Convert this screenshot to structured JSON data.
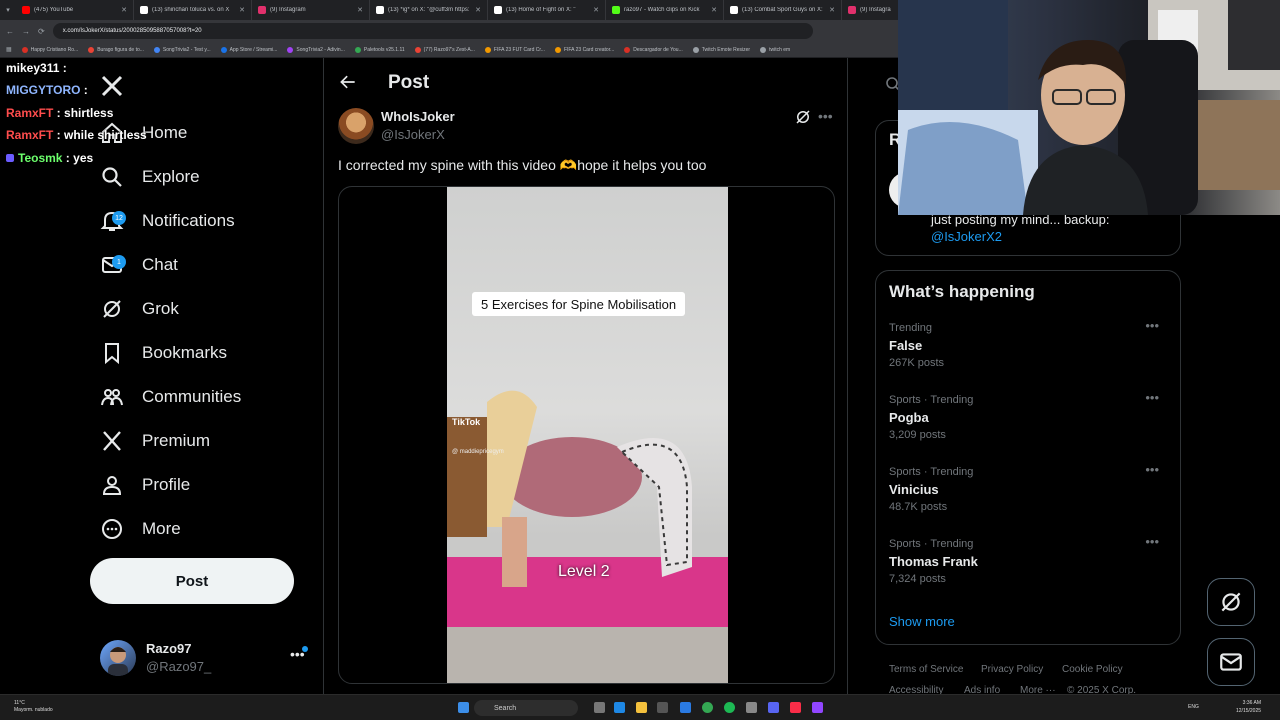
{
  "browser": {
    "tabs": [
      {
        "title": "(475) YouTube",
        "color": "#ff0000"
      },
      {
        "title": "(13) shinchan toluca vs. on X",
        "color": "#ffffff"
      },
      {
        "title": "(9) Instagram",
        "color": "#e1306c"
      },
      {
        "title": "(13) *ig* on X: \"@cuff3m https:",
        "color": "#ffffff"
      },
      {
        "title": "(13) Home of Fight on X: \"",
        "color": "#ffffff"
      },
      {
        "title": "razo97 - Watch clips on Kick",
        "color": "#53fc18"
      },
      {
        "title": "(13) Combat Sport Guys on X:",
        "color": "#ffffff"
      },
      {
        "title": "(9) Instagra",
        "color": "#e1306c"
      }
    ],
    "url": "x.com/IsJokerX/status/2000285095887057008?t=20",
    "bookmarks": [
      "Happy Cristiano Ro...",
      "Burago figura de to...",
      "SongTrivia2 - Test y...",
      "App Store / Streami...",
      "SongTrivia2 - Adivin...",
      "Paletools v25.1.11",
      "(77) Razo97's Zest-A...",
      "FIFA 23 FUT Card Cr...",
      "FIFA 23 Card creator...",
      "Descargador de You...",
      "Twitch Emote Resizer",
      "twitch em"
    ]
  },
  "chat": [
    {
      "user": "mikey311",
      "msg": "",
      "color": "#ffffff"
    },
    {
      "user": "MIGGYTORO",
      "msg": "",
      "color": "#8fb6ff"
    },
    {
      "user": "RamxFT",
      "msg": "shirtless",
      "color": "#ff4d4d"
    },
    {
      "user": "RamxFT",
      "msg": "while shirtless",
      "color": "#ff4d4d"
    },
    {
      "user": "Teosmk",
      "msg": "yes",
      "color": "#6cff6c"
    }
  ],
  "nav": {
    "items": [
      {
        "label": "Home",
        "icon": "home-icon"
      },
      {
        "label": "Explore",
        "icon": "search-icon"
      },
      {
        "label": "Notifications",
        "icon": "bell-icon",
        "badge": "12"
      },
      {
        "label": "Chat",
        "icon": "mail-icon",
        "badge": "1"
      },
      {
        "label": "Grok",
        "icon": "grok-icon"
      },
      {
        "label": "Bookmarks",
        "icon": "bookmark-icon"
      },
      {
        "label": "Communities",
        "icon": "communities-icon"
      },
      {
        "label": "Premium",
        "icon": "x-logo-icon"
      },
      {
        "label": "Profile",
        "icon": "profile-icon"
      },
      {
        "label": "More",
        "icon": "more-circle-icon"
      }
    ],
    "post_button": "Post",
    "account": {
      "name": "Razo97",
      "handle": "@Razo97_"
    }
  },
  "post": {
    "header_title": "Post",
    "author_name": "WhoIsJoker",
    "author_handle": "@IsJokerX",
    "text": "I corrected my spine with this video 🫶hope it helps you too",
    "video_caption": "5 Exercises for Spine Mobilisation",
    "video_level": "Level 2",
    "watermark": "TikTok",
    "watermark_handle": "@ maddiepricegym"
  },
  "sidebar": {
    "relevant_initial": "R",
    "relevant_bio": "just posting my mind... backup:",
    "relevant_link": "@IsJokerX2",
    "trends_title": "What’s happening",
    "trends": [
      {
        "context": "Trending",
        "name": "False",
        "count": "267K posts"
      },
      {
        "context": "Sports · Trending",
        "name": "Pogba",
        "count": "3,209 posts"
      },
      {
        "context": "Sports · Trending",
        "name": "Vinicius",
        "count": "48.7K posts"
      },
      {
        "context": "Sports · Trending",
        "name": "Thomas Frank",
        "count": "7,324 posts"
      }
    ],
    "show_more": "Show more",
    "footer": [
      "Terms of Service",
      "Privacy Policy",
      "Cookie Policy",
      "Accessibility",
      "Ads info",
      "More ···",
      "© 2025 X Corp."
    ]
  },
  "taskbar": {
    "weather_temp": "11°C",
    "weather_desc": "Mayorm. nublado",
    "search": "Search",
    "lang": "ENG",
    "time": "3:36 AM",
    "date": "12/15/2025"
  }
}
